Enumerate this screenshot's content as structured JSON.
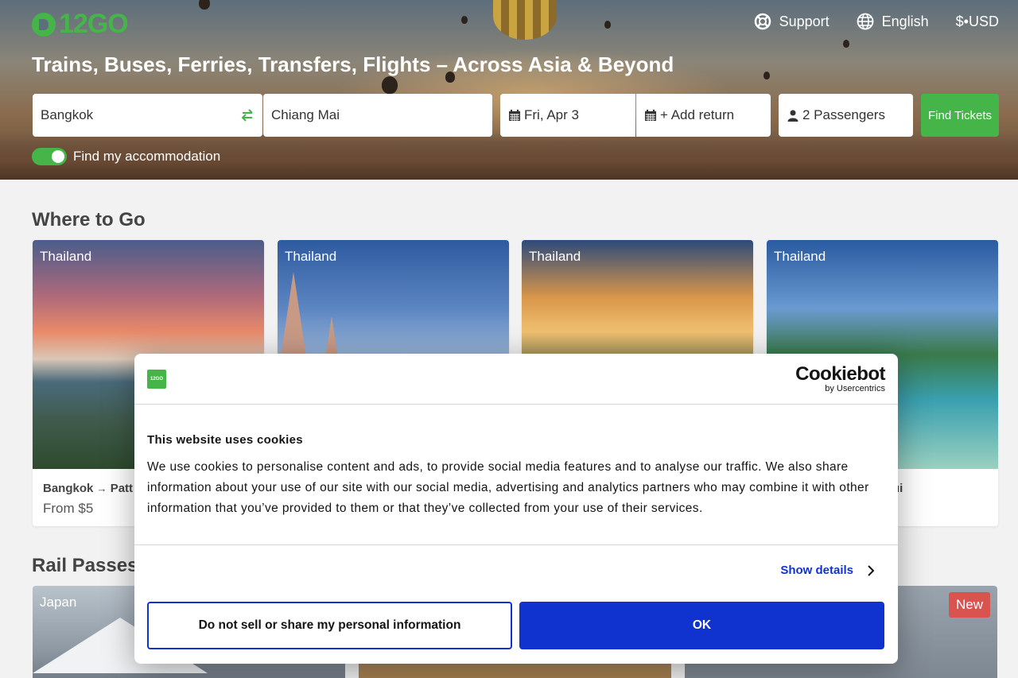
{
  "header": {
    "logo_text": "12GO",
    "nav": {
      "support": "Support",
      "language": "English",
      "currency": "$•USD"
    },
    "title": "Trains, Buses, Ferries, Transfers, Flights – Across Asia & Beyond"
  },
  "search": {
    "from": "Bangkok",
    "to": "Chiang Mai",
    "date": "Fri, Apr 3",
    "return": "+ Add return",
    "passengers": "2 Passengers",
    "find_button": "Find Tickets",
    "accommodation_label": "Find my accommodation",
    "accommodation_on": true
  },
  "where_to_go": {
    "title": "Where to Go",
    "cards": [
      {
        "country": "Thailand",
        "route_from": "Bangkok",
        "arrow": "→",
        "route_to": "Patt",
        "price": "From $5"
      },
      {
        "country": "Thailand"
      },
      {
        "country": "Thailand"
      },
      {
        "country": "Thailand",
        "route_tail": "ui"
      }
    ]
  },
  "rail_passes": {
    "title": "Rail Passes",
    "cards": [
      {
        "country": "Japan"
      },
      {
        "badge": "New"
      }
    ]
  },
  "cookie_dialog": {
    "logo_text": "12GO",
    "brand_main": "Cookiebot",
    "brand_sub": "by Usercentrics",
    "title": "This website uses cookies",
    "body": "We use cookies to personalise content and ads, to provide social media features and to analyse our traffic. We also share information about your use of our site with our social media, advertising and analytics partners who may combine it with other information that you’ve provided to them or that they’ve collected from your use of their services.",
    "show_details": "Show details",
    "do_not_sell": "Do not sell or share my personal information",
    "ok": "OK"
  },
  "colors": {
    "brand_green": "#45b549",
    "cookie_blue": "#1032cf",
    "badge_red": "#d9534f"
  }
}
